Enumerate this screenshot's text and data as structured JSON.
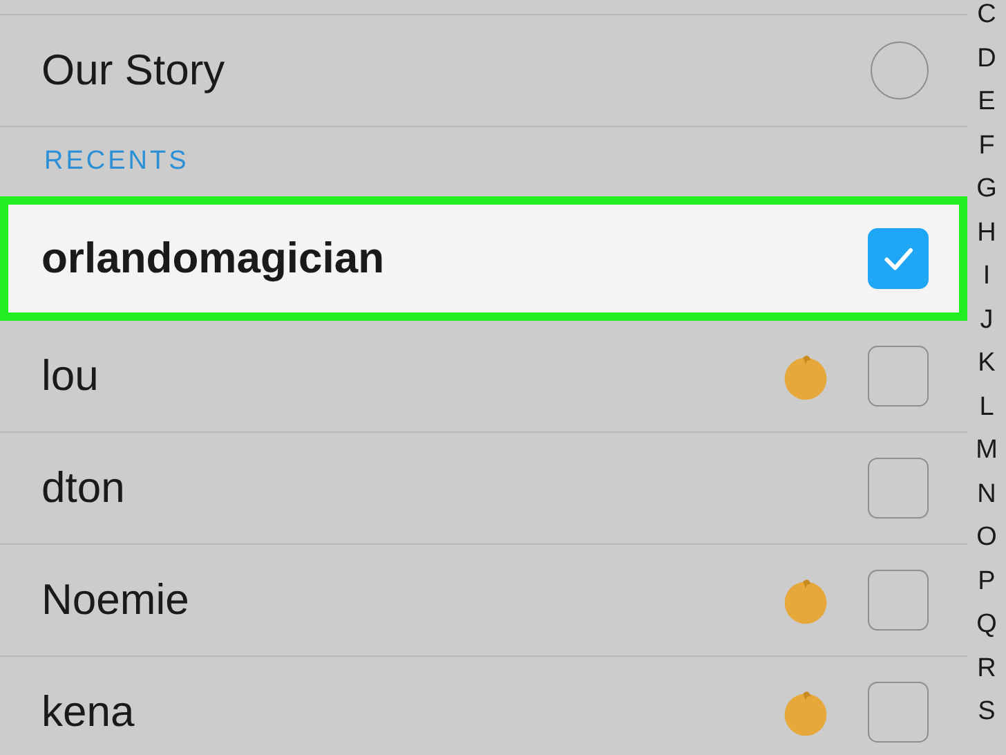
{
  "stories": [
    {
      "name": "Our Story",
      "kind": "circle",
      "selected": false
    }
  ],
  "recents": {
    "heading": "RECENTS",
    "rows": [
      {
        "name": "orlandomagician",
        "selected": true,
        "highlighted": true,
        "emoji": false
      },
      {
        "name": "lou",
        "selected": false,
        "highlighted": false,
        "emoji": true
      },
      {
        "name": "dton",
        "selected": false,
        "highlighted": false,
        "emoji": false
      },
      {
        "name": "Noemie",
        "selected": false,
        "highlighted": false,
        "emoji": true
      },
      {
        "name": "kena",
        "selected": false,
        "highlighted": false,
        "emoji": true
      }
    ]
  },
  "index": [
    "C",
    "D",
    "E",
    "F",
    "G",
    "H",
    "I",
    "J",
    "K",
    "L",
    "M",
    "N",
    "O",
    "P",
    "Q",
    "R",
    "S"
  ]
}
